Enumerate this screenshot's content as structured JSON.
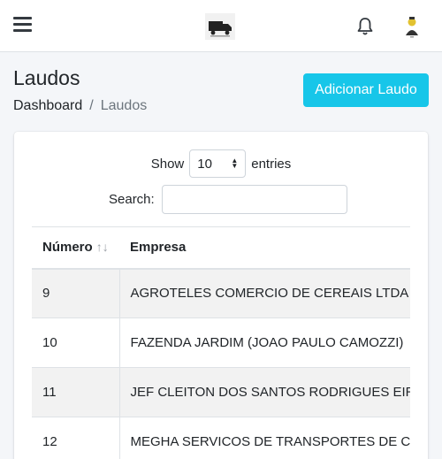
{
  "header": {
    "menu_icon": "hamburger-menu-icon",
    "logo_icon": "truck-logo-icon",
    "notification_icon": "bell-icon",
    "avatar_icon": "user-avatar-icon"
  },
  "page": {
    "title": "Laudos",
    "breadcrumb": {
      "home": "Dashboard",
      "separator": "/",
      "current": "Laudos"
    },
    "add_button": "Adicionar Laudo"
  },
  "datatable": {
    "show_label": "Show",
    "entries_value": "10",
    "entries_label": "entries",
    "search_label": "Search:",
    "search_value": "",
    "columns": [
      "Número",
      "Empresa"
    ],
    "rows": [
      {
        "numero": "9",
        "empresa": "AGROTELES COMERCIO DE CEREAIS LTDA"
      },
      {
        "numero": "10",
        "empresa": "FAZENDA JARDIM (JOAO PAULO CAMOZZI)"
      },
      {
        "numero": "11",
        "empresa": "JEF CLEITON DOS SANTOS RODRIGUES EIRELI"
      },
      {
        "numero": "12",
        "empresa": "MEGHA SERVICOS DE TRANSPORTES DE CARGAS"
      }
    ]
  },
  "colors": {
    "primary_button": "#17c6e9",
    "striped_row": "#f2f2f2",
    "background": "#f4f6f9"
  }
}
